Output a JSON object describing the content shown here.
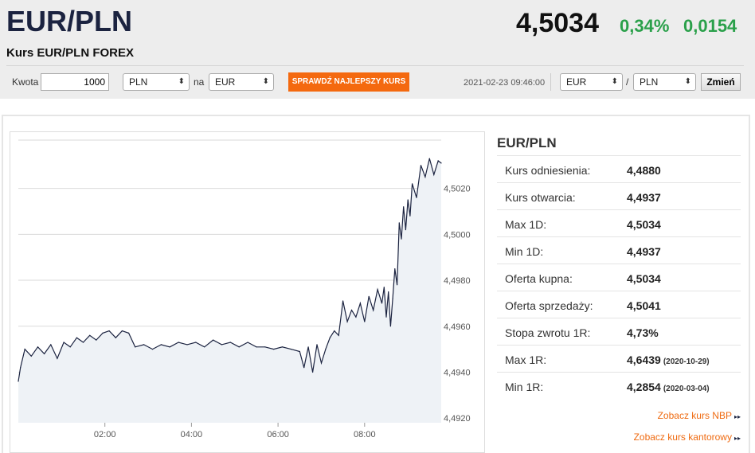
{
  "header": {
    "title": "EUR/PLN",
    "subtitle": "Kurs EUR/PLN FOREX",
    "price": "4,5034",
    "change_pct": "0,34%",
    "change_abs": "0,0154",
    "change_color": "#2aa04a"
  },
  "converter": {
    "amount_label": "Kwota",
    "amount_value": "1000",
    "from_currency": "PLN",
    "to_label": "na",
    "to_currency": "EUR",
    "best_rate_button": "SPRAWDŹ NAJLEPSZY KURS",
    "best_rate_color": "#f4690f",
    "timestamp": "2021-02-23 09:46:00",
    "pair_base": "EUR",
    "pair_sep": "/",
    "pair_quote": "PLN",
    "change_button": "Zmień"
  },
  "stats": {
    "title": "EUR/PLN",
    "rows": [
      {
        "label": "Kurs odniesienia:",
        "value": "4,4880",
        "date": ""
      },
      {
        "label": "Kurs otwarcia:",
        "value": "4,4937",
        "date": ""
      },
      {
        "label": "Max 1D:",
        "value": "4,5034",
        "date": ""
      },
      {
        "label": "Min 1D:",
        "value": "4,4937",
        "date": ""
      },
      {
        "label": "Oferta kupna:",
        "value": "4,5034",
        "date": ""
      },
      {
        "label": "Oferta sprzedaży:",
        "value": "4,5041",
        "date": ""
      },
      {
        "label": "Stopa zwrotu 1R:",
        "value": "4,73%",
        "date": ""
      },
      {
        "label": "Max 1R:",
        "value": "4,6439",
        "date": "(2020-10-29)"
      },
      {
        "label": "Min 1R:",
        "value": "4,2854",
        "date": "(2020-03-04)"
      }
    ]
  },
  "links": {
    "nbp": "Zobacz kurs NBP",
    "kantor": "Zobacz kurs kantorowy",
    "arrow": "▸▸"
  },
  "chart_data": {
    "type": "line",
    "x_tick_labels": [
      "02:00",
      "04:00",
      "06:00",
      "08:00"
    ],
    "x_ticks_hours": [
      2,
      4,
      6,
      8
    ],
    "xlim_hours": [
      0.0,
      9.77
    ],
    "y_tick_labels": [
      "4,4920",
      "4,4940",
      "4,4960",
      "4,4980",
      "4,5000",
      "4,5020"
    ],
    "y_ticks": [
      4.492,
      4.494,
      4.496,
      4.498,
      4.5,
      4.502
    ],
    "ylim": [
      4.4918,
      4.5041
    ],
    "grid": "horizontal",
    "line_color": "#1b2340",
    "area_color": "#eef2f6",
    "series": [
      {
        "x": [
          0.0,
          0.05,
          0.15,
          0.3,
          0.45,
          0.6,
          0.75,
          0.9,
          1.05,
          1.2,
          1.35,
          1.5,
          1.65,
          1.8,
          1.95,
          2.1,
          2.25,
          2.4,
          2.55,
          2.7,
          2.9,
          3.1,
          3.3,
          3.5,
          3.7,
          3.9,
          4.1,
          4.3,
          4.5,
          4.7,
          4.9,
          5.1,
          5.3,
          5.5,
          5.7,
          5.9,
          6.1,
          6.3,
          6.5,
          6.6,
          6.7,
          6.8,
          6.9,
          7.0,
          7.1,
          7.2,
          7.3,
          7.4,
          7.5,
          7.6,
          7.7,
          7.8,
          7.9,
          8.0,
          8.1,
          8.2,
          8.3,
          8.4,
          8.45,
          8.5,
          8.55,
          8.6,
          8.65,
          8.7,
          8.75,
          8.8,
          8.85,
          8.9,
          8.95,
          9.0,
          9.05,
          9.1,
          9.2,
          9.3,
          9.4,
          9.5,
          9.6,
          9.7,
          9.77
        ],
        "y": [
          4.4936,
          4.4942,
          4.495,
          4.4947,
          4.4951,
          4.4948,
          4.4952,
          4.4946,
          4.4953,
          4.4951,
          4.4955,
          4.4953,
          4.4956,
          4.4954,
          4.4957,
          4.4958,
          4.4955,
          4.4958,
          4.4957,
          4.4951,
          4.4952,
          4.495,
          4.4952,
          4.4951,
          4.4953,
          4.4952,
          4.4953,
          4.4951,
          4.4954,
          4.4952,
          4.4953,
          4.4951,
          4.4953,
          4.4951,
          4.4951,
          4.495,
          4.4951,
          4.495,
          4.4949,
          4.4942,
          4.4951,
          4.494,
          4.4952,
          4.4944,
          4.495,
          4.4955,
          4.4958,
          4.4956,
          4.4971,
          4.4962,
          4.4967,
          4.4964,
          4.497,
          4.4962,
          4.4973,
          4.4967,
          4.4976,
          4.497,
          4.4977,
          4.4964,
          4.4975,
          4.496,
          4.4972,
          4.4985,
          4.4978,
          4.5005,
          4.4998,
          4.5012,
          4.5002,
          4.5015,
          4.5008,
          4.5022,
          4.5016,
          4.503,
          4.5025,
          4.5033,
          4.5026,
          4.5032,
          4.5031
        ]
      }
    ]
  }
}
